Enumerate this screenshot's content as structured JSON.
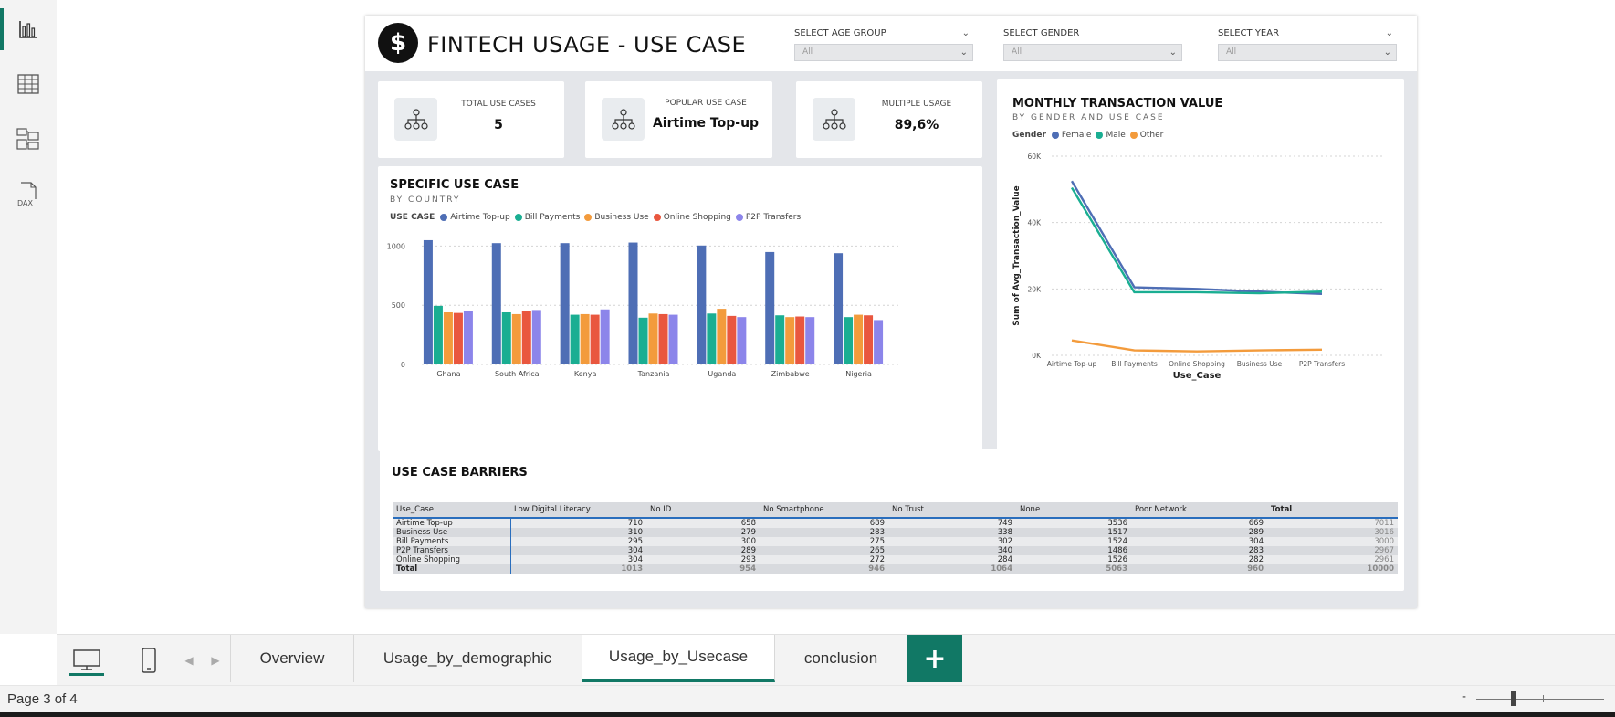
{
  "app": {
    "rail": [
      "report-view-icon",
      "table-view-icon",
      "model-view-icon",
      "dax-query-icon"
    ],
    "dax_label": "DAX",
    "accent": "#117865"
  },
  "report": {
    "logo_symbol": "$",
    "title": "FINTECH USAGE - USE CASE",
    "slicers": [
      {
        "label": "SELECT AGE GROUP",
        "value": "All"
      },
      {
        "label": "SELECT GENDER",
        "value": "All"
      },
      {
        "label": "SELECT YEAR",
        "value": "All"
      }
    ],
    "kpis": [
      {
        "label": "TOTAL USE CASES",
        "value": "5"
      },
      {
        "label": "POPULAR USE CASE",
        "value": "Airtime Top-up"
      },
      {
        "label": "MULTIPLE USAGE",
        "value": "89,6%"
      }
    ],
    "bar_visual": {
      "title": "SPECIFIC USE CASE",
      "subtitle": "BY COUNTRY",
      "legend_title": "USE CASE"
    },
    "line_visual": {
      "title": "MONTHLY TRANSACTION VALUE",
      "subtitle": "BY GENDER AND USE CASE",
      "legend_title": "Gender"
    },
    "matrix": {
      "title": "USE CASE BARRIERS",
      "columns": [
        "Use_Case",
        "Low Digital Literacy",
        "No ID",
        "No Smartphone",
        "No Trust",
        "None",
        "Poor Network",
        "Total"
      ],
      "rows": [
        [
          "Airtime Top-up",
          "710",
          "658",
          "689",
          "749",
          "3536",
          "669",
          "7011"
        ],
        [
          "Business Use",
          "310",
          "279",
          "283",
          "338",
          "1517",
          "289",
          "3016"
        ],
        [
          "Bill Payments",
          "295",
          "300",
          "275",
          "302",
          "1524",
          "304",
          "3000"
        ],
        [
          "P2P Transfers",
          "304",
          "289",
          "265",
          "340",
          "1486",
          "283",
          "2967"
        ],
        [
          "Online Shopping",
          "304",
          "293",
          "272",
          "284",
          "1526",
          "282",
          "2961"
        ]
      ],
      "total_row": [
        "Total",
        "1013",
        "954",
        "946",
        "1064",
        "5063",
        "960",
        "10000"
      ]
    }
  },
  "chart_data": [
    {
      "type": "bar",
      "title": "SPECIFIC USE CASE",
      "subtitle": "BY COUNTRY",
      "legend_title": "USE CASE",
      "categories": [
        "Ghana",
        "South Africa",
        "Kenya",
        "Tanzania",
        "Uganda",
        "Zimbabwe",
        "Nigeria"
      ],
      "series": [
        {
          "name": "Airtime Top-up",
          "color": "#4e6eb5",
          "values": [
            1050,
            1025,
            1025,
            1030,
            1005,
            950,
            940
          ]
        },
        {
          "name": "Bill Payments",
          "color": "#1aae92",
          "values": [
            495,
            440,
            420,
            395,
            430,
            415,
            400
          ]
        },
        {
          "name": "Business Use",
          "color": "#f39b3c",
          "values": [
            440,
            425,
            425,
            430,
            470,
            400,
            420
          ]
        },
        {
          "name": "Online Shopping",
          "color": "#e9573f",
          "values": [
            435,
            450,
            420,
            425,
            410,
            405,
            415
          ]
        },
        {
          "name": "P2P Transfers",
          "color": "#8c85ea",
          "values": [
            450,
            460,
            465,
            420,
            400,
            400,
            375
          ]
        }
      ],
      "y_ticks": [
        "1000",
        "500",
        "0"
      ],
      "ylim": [
        0,
        1150
      ]
    },
    {
      "type": "line",
      "title": "MONTHLY TRANSACTION VALUE",
      "subtitle": "BY GENDER AND USE CASE",
      "legend_title": "Gender",
      "xlabel": "Use_Case",
      "ylabel": "Sum of Avg_Transaction_Value",
      "x": [
        "Airtime Top-up",
        "Bill Payments",
        "Online Shopping",
        "Business Use",
        "P2P Transfers"
      ],
      "series": [
        {
          "name": "Female",
          "color": "#4e6eb5",
          "values": [
            52500,
            20500,
            20000,
            19200,
            18500
          ]
        },
        {
          "name": "Male",
          "color": "#1aae92",
          "values": [
            50500,
            19000,
            19000,
            18700,
            19200
          ]
        },
        {
          "name": "Other",
          "color": "#f39b3c",
          "values": [
            4500,
            1500,
            1200,
            1500,
            1700
          ]
        }
      ],
      "y_ticks": [
        "60K",
        "40K",
        "20K",
        "0K"
      ],
      "ylim": [
        0,
        60000
      ]
    }
  ],
  "pagebar": {
    "tabs": [
      "Overview",
      "Usage_by_demographic",
      "Usage_by_Usecase",
      "conclusion"
    ],
    "active_tab": "Usage_by_Usecase",
    "add_label": "+"
  },
  "status": {
    "page": "Page 3 of 4",
    "zoom_minus": "-"
  }
}
